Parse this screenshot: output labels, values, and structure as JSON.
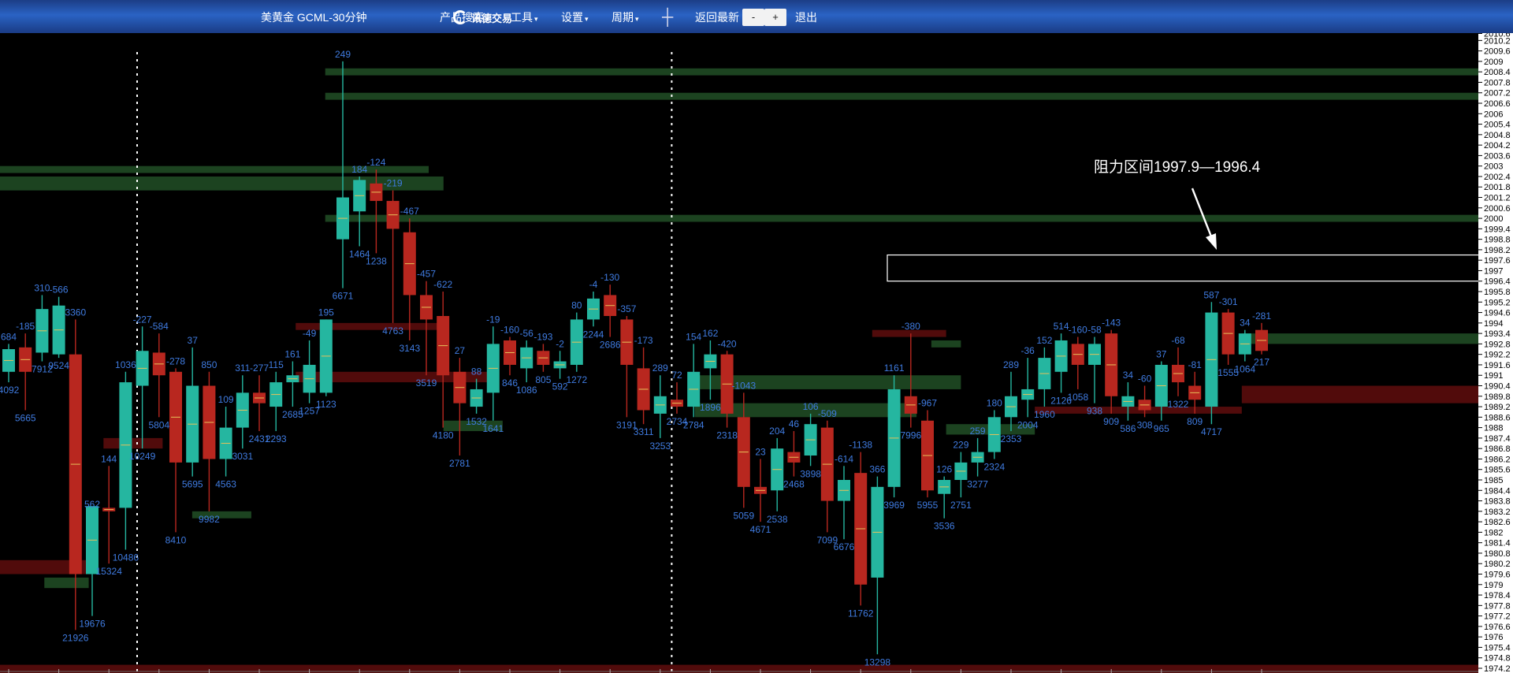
{
  "toolbar": {
    "symbol_title": "美黄金 GCML-30分钟",
    "logo_text": "讯德交易",
    "product_search": "产品搜索",
    "tools": "工具",
    "settings": "设置",
    "period": "周期",
    "crosshair_icon": "crosshair-icon",
    "back_latest": "返回最新",
    "zoom_out": "-",
    "zoom_in": "+",
    "exit": "退出"
  },
  "colors": {
    "up": "#25b6a0",
    "down": "#b8271f",
    "volume_label": "#3f7be0",
    "wick_mid": "#e6c15a",
    "zone_green": "#1f4a24",
    "zone_red": "#5a0c0c",
    "axis_bg": "#ffffff",
    "toolbar": "#2a63c4"
  },
  "chart_data": {
    "type": "candlestick",
    "title": "美黄金 GCML-30分钟",
    "annotation": "阻力区间1997.9—1996.4",
    "resistance_zone": [
      1996.4,
      1997.9
    ],
    "ylim": [
      1974.2,
      2010.6
    ],
    "y_ticks": [
      "2010.6",
      "2010.2",
      "2009.6",
      "2009",
      "2008.4",
      "2007.8",
      "2007.2",
      "2006.6",
      "2006",
      "2005.4",
      "2004.8",
      "2004.2",
      "2003.6",
      "2003",
      "2002.4",
      "2001.8",
      "2001.2",
      "2000.6",
      "2000",
      "1999.4",
      "1998.8",
      "1998.2",
      "1997.6",
      "1997",
      "1996.4",
      "1995.8",
      "1995.2",
      "1994.6",
      "1994",
      "1993.4",
      "1992.8",
      "1992.2",
      "1991.6",
      "1991",
      "1990.4",
      "1989.8",
      "1989.2",
      "1988.6",
      "1988",
      "1987.4",
      "1986.8",
      "1986.2",
      "1985.6",
      "1985",
      "1984.4",
      "1983.8",
      "1983.2",
      "1982.6",
      "1982",
      "1981.4",
      "1980.8",
      "1980.2",
      "1979.6",
      "1979",
      "1978.4",
      "1977.8",
      "1977.2",
      "1976.6",
      "1976",
      "1975.4",
      "1974.8",
      "1974.2"
    ],
    "session_separators": [
      7,
      39
    ],
    "candles": [
      {
        "o": 1991.2,
        "h": 1992.8,
        "l": 1990.6,
        "c": 1992.5,
        "top": "684",
        "bot": "4092"
      },
      {
        "o": 1992.6,
        "h": 1993.4,
        "l": 1989.0,
        "c": 1991.2,
        "top": "-185",
        "bot": "5665"
      },
      {
        "o": 1992.3,
        "h": 1995.6,
        "l": 1991.8,
        "c": 1994.8,
        "top": "310",
        "bot": "7912"
      },
      {
        "o": 1992.2,
        "h": 1995.5,
        "l": 1992.0,
        "c": 1995.0,
        "top": "-566",
        "bot": "9524"
      },
      {
        "o": 1992.2,
        "h": 1994.2,
        "l": 1976.4,
        "c": 1979.6,
        "top": "3360",
        "bot": "21926"
      },
      {
        "o": 1979.6,
        "h": 1983.2,
        "l": 1977.2,
        "c": 1983.5,
        "top": "562",
        "bot": "19676"
      },
      {
        "o": 1983.4,
        "h": 1985.8,
        "l": 1980.2,
        "c": 1983.2,
        "top": "144",
        "bot": "15324"
      },
      {
        "o": 1983.4,
        "h": 1991.2,
        "l": 1981.0,
        "c": 1990.6,
        "top": "1036",
        "bot": "10486"
      },
      {
        "o": 1990.4,
        "h": 1993.8,
        "l": 1986.8,
        "c": 1992.4,
        "top": "-227",
        "bot": "10249"
      },
      {
        "o": 1992.3,
        "h": 1993.4,
        "l": 1988.6,
        "c": 1991.0,
        "top": "-584",
        "bot": "5804"
      },
      {
        "o": 1991.2,
        "h": 1991.4,
        "l": 1982.0,
        "c": 1986.0,
        "top": "-278",
        "bot": "8410"
      },
      {
        "o": 1986.0,
        "h": 1992.6,
        "l": 1985.2,
        "c": 1990.4,
        "top": "37",
        "bot": "5695"
      },
      {
        "o": 1990.4,
        "h": 1991.2,
        "l": 1983.2,
        "c": 1986.2,
        "top": "850",
        "bot": "9982"
      },
      {
        "o": 1986.2,
        "h": 1989.2,
        "l": 1985.2,
        "c": 1988.0,
        "top": "109",
        "bot": "4563"
      },
      {
        "o": 1988.0,
        "h": 1991.0,
        "l": 1986.8,
        "c": 1990.0,
        "top": "311",
        "bot": "3031"
      },
      {
        "o": 1990.0,
        "h": 1991.0,
        "l": 1987.8,
        "c": 1989.4,
        "top": "-277",
        "bot": "2431"
      },
      {
        "o": 1989.2,
        "h": 1991.2,
        "l": 1987.8,
        "c": 1990.6,
        "top": "115",
        "bot": "2293"
      },
      {
        "o": 1990.6,
        "h": 1991.8,
        "l": 1989.2,
        "c": 1991.0,
        "top": "161",
        "bot": "2685"
      },
      {
        "o": 1990.0,
        "h": 1993.0,
        "l": 1989.4,
        "c": 1991.6,
        "top": "-49",
        "bot": "1257"
      },
      {
        "o": 1990.0,
        "h": 1994.2,
        "l": 1989.8,
        "c": 1994.2,
        "top": "195",
        "bot": "1123"
      },
      {
        "o": 1998.8,
        "h": 2009.0,
        "l": 1996.0,
        "c": 2001.2,
        "top": "249",
        "bot": "6671"
      },
      {
        "o": 2000.4,
        "h": 2002.4,
        "l": 1998.4,
        "c": 2002.2,
        "top": "184",
        "bot": "1464"
      },
      {
        "o": 2002.0,
        "h": 2002.8,
        "l": 1998.0,
        "c": 2001.0,
        "top": "-124",
        "bot": "1238"
      },
      {
        "o": 2001.0,
        "h": 2001.6,
        "l": 1994.0,
        "c": 1999.4,
        "top": "-219",
        "bot": "4763"
      },
      {
        "o": 1999.2,
        "h": 2000.0,
        "l": 1993.0,
        "c": 1995.6,
        "top": "-467",
        "bot": "3143"
      },
      {
        "o": 1995.6,
        "h": 1996.4,
        "l": 1991.0,
        "c": 1994.2,
        "top": "-457",
        "bot": "3519"
      },
      {
        "o": 1994.4,
        "h": 1995.8,
        "l": 1988.0,
        "c": 1991.0,
        "top": "-622",
        "bot": "4180"
      },
      {
        "o": 1991.2,
        "h": 1992.0,
        "l": 1986.4,
        "c": 1989.4,
        "top": "27",
        "bot": "2781"
      },
      {
        "o": 1989.2,
        "h": 1990.8,
        "l": 1988.8,
        "c": 1990.2,
        "top": "88",
        "bot": "1532"
      },
      {
        "o": 1990.0,
        "h": 1993.8,
        "l": 1988.4,
        "c": 1992.8,
        "top": "-19",
        "bot": "1641"
      },
      {
        "o": 1993.0,
        "h": 1993.2,
        "l": 1991.0,
        "c": 1991.6,
        "top": "-160",
        "bot": "846"
      },
      {
        "o": 1991.4,
        "h": 1993.0,
        "l": 1990.6,
        "c": 1992.6,
        "top": "-56",
        "bot": "1086"
      },
      {
        "o": 1992.4,
        "h": 1992.8,
        "l": 1991.2,
        "c": 1991.6,
        "top": "-193",
        "bot": "805"
      },
      {
        "o": 1991.4,
        "h": 1992.4,
        "l": 1990.8,
        "c": 1991.8,
        "top": "-2",
        "bot": "592"
      },
      {
        "o": 1991.6,
        "h": 1994.6,
        "l": 1991.2,
        "c": 1994.2,
        "top": "80",
        "bot": "1272"
      },
      {
        "o": 1994.2,
        "h": 1995.8,
        "l": 1993.8,
        "c": 1995.4,
        "top": "-4",
        "bot": "2244"
      },
      {
        "o": 1995.6,
        "h": 1996.2,
        "l": 1993.2,
        "c": 1994.4,
        "top": "-130",
        "bot": "2686"
      },
      {
        "o": 1994.2,
        "h": 1994.4,
        "l": 1988.6,
        "c": 1991.6,
        "top": "-357",
        "bot": "3191"
      },
      {
        "o": 1991.4,
        "h": 1992.6,
        "l": 1988.2,
        "c": 1989.0,
        "top": "-173",
        "bot": "3311"
      },
      {
        "o": 1988.8,
        "h": 1991.0,
        "l": 1987.4,
        "c": 1989.8,
        "top": "289",
        "bot": "3253"
      },
      {
        "o": 1989.6,
        "h": 1990.6,
        "l": 1988.8,
        "c": 1989.2,
        "top": "72",
        "bot": "2734"
      },
      {
        "o": 1989.2,
        "h": 1992.8,
        "l": 1988.6,
        "c": 1991.2,
        "top": "154",
        "bot": "2784"
      },
      {
        "o": 1991.4,
        "h": 1993.0,
        "l": 1989.6,
        "c": 1992.2,
        "top": "162",
        "bot": "1896"
      },
      {
        "o": 1992.2,
        "h": 1992.4,
        "l": 1988.0,
        "c": 1988.8,
        "top": "-420",
        "bot": "2318"
      },
      {
        "o": 1988.6,
        "h": 1990.0,
        "l": 1983.4,
        "c": 1984.6,
        "top": "-1043",
        "bot": "5059"
      },
      {
        "o": 1984.6,
        "h": 1986.2,
        "l": 1982.6,
        "c": 1984.2,
        "top": "23",
        "bot": "4671"
      },
      {
        "o": 1984.4,
        "h": 1987.4,
        "l": 1983.2,
        "c": 1986.8,
        "top": "204",
        "bot": "2538"
      },
      {
        "o": 1986.6,
        "h": 1987.8,
        "l": 1985.2,
        "c": 1986.0,
        "top": "46",
        "bot": "2468"
      },
      {
        "o": 1986.4,
        "h": 1988.8,
        "l": 1985.8,
        "c": 1988.2,
        "top": "106",
        "bot": "3898"
      },
      {
        "o": 1988.0,
        "h": 1988.4,
        "l": 1982.0,
        "c": 1983.8,
        "top": "-509",
        "bot": "7099"
      },
      {
        "o": 1983.8,
        "h": 1985.8,
        "l": 1981.6,
        "c": 1985.0,
        "top": "-614",
        "bot": "6676"
      },
      {
        "o": 1985.4,
        "h": 1986.6,
        "l": 1977.8,
        "c": 1979.0,
        "top": "-1138",
        "bot": "11762"
      },
      {
        "o": 1979.4,
        "h": 1985.2,
        "l": 1975.0,
        "c": 1984.6,
        "top": "366",
        "bot": "13298"
      },
      {
        "o": 1984.6,
        "h": 1991.0,
        "l": 1984.0,
        "c": 1990.2,
        "top": "1161",
        "bot": "3969"
      },
      {
        "o": 1989.8,
        "h": 1993.4,
        "l": 1988.0,
        "c": 1988.8,
        "top": "-380",
        "bot": "7996"
      },
      {
        "o": 1988.4,
        "h": 1989.0,
        "l": 1984.0,
        "c": 1984.4,
        "top": "-967",
        "bot": "5955"
      },
      {
        "o": 1984.2,
        "h": 1985.2,
        "l": 1982.8,
        "c": 1985.0,
        "top": "126",
        "bot": "3536"
      },
      {
        "o": 1985.0,
        "h": 1986.6,
        "l": 1984.0,
        "c": 1986.0,
        "top": "229",
        "bot": "2751"
      },
      {
        "o": 1986.0,
        "h": 1987.4,
        "l": 1985.2,
        "c": 1986.6,
        "top": "259",
        "bot": "3277"
      },
      {
        "o": 1986.6,
        "h": 1989.0,
        "l": 1986.2,
        "c": 1988.6,
        "top": "180",
        "bot": "2324"
      },
      {
        "o": 1988.6,
        "h": 1991.2,
        "l": 1987.8,
        "c": 1989.8,
        "top": "289",
        "bot": "2353"
      },
      {
        "o": 1989.6,
        "h": 1992.0,
        "l": 1988.6,
        "c": 1990.2,
        "top": "-36",
        "bot": "2004"
      },
      {
        "o": 1990.2,
        "h": 1992.6,
        "l": 1989.2,
        "c": 1992.0,
        "top": "152",
        "bot": "1960"
      },
      {
        "o": 1991.2,
        "h": 1993.4,
        "l": 1990.0,
        "c": 1993.0,
        "top": "514",
        "bot": "2126"
      },
      {
        "o": 1992.8,
        "h": 1993.2,
        "l": 1990.2,
        "c": 1991.6,
        "top": "-160",
        "bot": "1058"
      },
      {
        "o": 1991.6,
        "h": 1993.2,
        "l": 1989.4,
        "c": 1992.8,
        "top": "-58",
        "bot": "938"
      },
      {
        "o": 1993.4,
        "h": 1993.6,
        "l": 1988.8,
        "c": 1989.8,
        "top": "-143",
        "bot": "909"
      },
      {
        "o": 1989.2,
        "h": 1990.6,
        "l": 1988.4,
        "c": 1989.8,
        "top": "34",
        "bot": "586"
      },
      {
        "o": 1989.6,
        "h": 1990.4,
        "l": 1988.6,
        "c": 1989.0,
        "top": "-60",
        "bot": "308"
      },
      {
        "o": 1989.2,
        "h": 1991.8,
        "l": 1988.4,
        "c": 1991.6,
        "top": "37",
        "bot": "965"
      },
      {
        "o": 1991.6,
        "h": 1992.6,
        "l": 1989.8,
        "c": 1990.6,
        "top": "-68",
        "bot": "1322"
      },
      {
        "o": 1990.4,
        "h": 1991.2,
        "l": 1988.8,
        "c": 1989.6,
        "top": "-81",
        "bot": "809"
      },
      {
        "o": 1989.2,
        "h": 1995.2,
        "l": 1988.2,
        "c": 1994.6,
        "top": "587",
        "bot": "4717"
      },
      {
        "o": 1994.6,
        "h": 1994.8,
        "l": 1991.6,
        "c": 1992.2,
        "top": "-301",
        "bot": "1555"
      },
      {
        "o": 1992.2,
        "h": 1993.6,
        "l": 1991.8,
        "c": 1993.4,
        "top": "34",
        "bot": "1064"
      },
      {
        "o": 1993.6,
        "h": 1994.0,
        "l": 1992.2,
        "c": 1992.4,
        "top": "-281",
        "bot": "217"
      }
    ],
    "volume_zones": [
      {
        "from": 1973.8,
        "to": 1974.4,
        "kind": "red",
        "x0": 0,
        "x1": 1.0
      },
      {
        "from": 2001.6,
        "to": 2002.4,
        "kind": "green",
        "x0": 0,
        "x1": 0.3
      },
      {
        "from": 2002.6,
        "to": 2003.0,
        "kind": "green",
        "x0": 0,
        "x1": 0.29
      },
      {
        "from": 2008.2,
        "to": 2008.6,
        "kind": "green",
        "x0": 0.22,
        "x1": 1.0
      },
      {
        "from": 2006.8,
        "to": 2007.2,
        "kind": "green",
        "x0": 0.22,
        "x1": 1.0
      },
      {
        "from": 1999.8,
        "to": 2000.2,
        "kind": "green",
        "x0": 0.22,
        "x1": 1.0
      },
      {
        "from": 1989.4,
        "to": 1990.4,
        "kind": "red",
        "x0": 0.84,
        "x1": 1.0
      },
      {
        "from": 1992.8,
        "to": 1993.4,
        "kind": "green",
        "x0": 0.84,
        "x1": 1.0
      },
      {
        "from": 1992.6,
        "to": 1993.0,
        "kind": "green",
        "x0": 0.63,
        "x1": 0.65
      },
      {
        "from": 1990.2,
        "to": 1991.0,
        "kind": "green",
        "x0": 0.47,
        "x1": 0.65
      },
      {
        "from": 1988.6,
        "to": 1989.4,
        "kind": "green",
        "x0": 0.47,
        "x1": 0.62
      },
      {
        "from": 1979.6,
        "to": 1980.4,
        "kind": "red",
        "x0": 0,
        "x1": 0.06
      },
      {
        "from": 1978.8,
        "to": 1979.4,
        "kind": "green",
        "x0": 0.03,
        "x1": 0.06
      },
      {
        "from": 1990.6,
        "to": 1991.2,
        "kind": "red",
        "x0": 0.2,
        "x1": 0.33
      },
      {
        "from": 1993.6,
        "to": 1994.0,
        "kind": "red",
        "x0": 0.2,
        "x1": 0.3
      },
      {
        "from": 1993.2,
        "to": 1993.6,
        "kind": "red",
        "x0": 0.59,
        "x1": 0.64
      },
      {
        "from": 1987.6,
        "to": 1988.2,
        "kind": "green",
        "x0": 0.64,
        "x1": 0.7
      },
      {
        "from": 1988.8,
        "to": 1989.2,
        "kind": "red",
        "x0": 0.7,
        "x1": 0.84
      },
      {
        "from": 1987.8,
        "to": 1988.4,
        "kind": "green",
        "x0": 0.3,
        "x1": 0.34
      },
      {
        "from": 1986.8,
        "to": 1987.4,
        "kind": "red",
        "x0": 0.07,
        "x1": 0.11
      },
      {
        "from": 1982.8,
        "to": 1983.2,
        "kind": "green",
        "x0": 0.13,
        "x1": 0.17
      }
    ]
  }
}
